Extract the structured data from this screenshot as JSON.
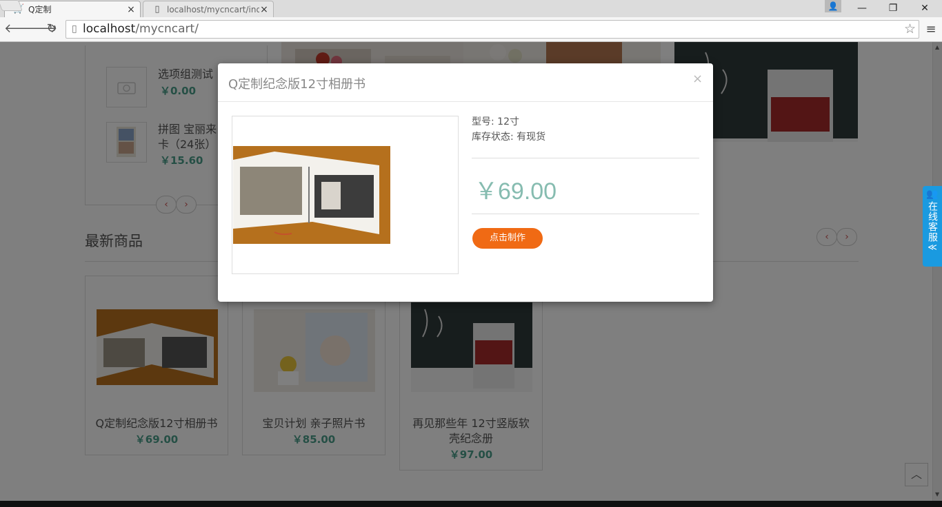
{
  "browser": {
    "tabs": [
      {
        "title": "Q定制",
        "close": "×"
      },
      {
        "title": "localhost/mycncart/inde",
        "close": "×"
      }
    ],
    "window_controls": {
      "minimize": "—",
      "restore": "❐",
      "close": "✕"
    },
    "url_host": "localhost",
    "url_path": "/mycncart/"
  },
  "sidebar": {
    "items": [
      {
        "name": "选项组测试",
        "price": "￥0.00"
      },
      {
        "name": "拼图 宝丽来卡（24张）",
        "price": "￥15.60"
      }
    ],
    "pager": {
      "prev": "‹",
      "next": "›"
    }
  },
  "section": {
    "title": "最新商品",
    "nav_prev": "‹",
    "nav_next": "›"
  },
  "products": [
    {
      "name": "Q定制纪念版12寸相册书",
      "price": "￥69.00"
    },
    {
      "name": "宝贝计划 亲子照片书",
      "price": "￥85.00"
    },
    {
      "name": "再见那些年 12寸竖版软壳纪念册",
      "price": "￥97.00"
    }
  ],
  "service_tab": {
    "label": "在线客服",
    "collapse": "≪"
  },
  "back_to_top": "︿",
  "modal": {
    "title": "Q定制纪念版12寸相册书",
    "close": "×",
    "model_line": "型号: 12寸",
    "stock_line": "库存状态: 有现货",
    "price": "￥69.00",
    "button": "点击制作"
  },
  "colors": {
    "price_green": "#4b9f8b",
    "modal_price": "#86bcb0",
    "accent_orange": "#f06a14",
    "service_blue": "#1a9ae0"
  }
}
